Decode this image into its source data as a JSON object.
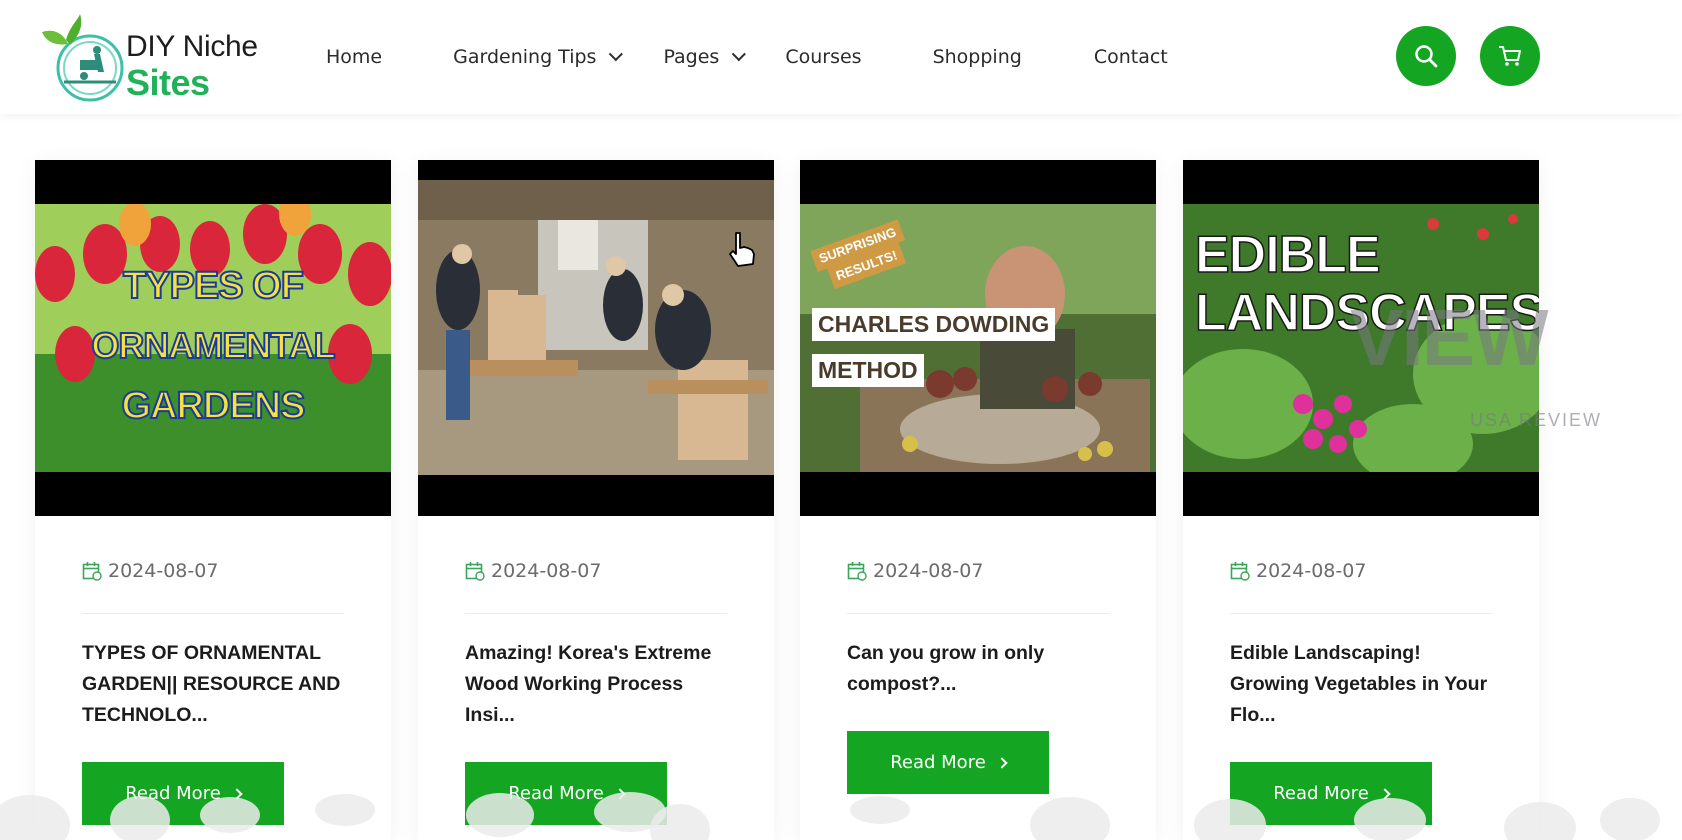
{
  "header": {
    "logo": {
      "line1": "DIY Niche",
      "line2": "Sites",
      "icon": "gardener-wheelbarrow-logo-icon"
    },
    "nav": [
      {
        "label": "Home",
        "has_dropdown": false
      },
      {
        "label": "Gardening Tips",
        "has_dropdown": true
      },
      {
        "label": "Pages",
        "has_dropdown": true
      },
      {
        "label": "Courses",
        "has_dropdown": false
      },
      {
        "label": "Shopping",
        "has_dropdown": false
      },
      {
        "label": "Contact",
        "has_dropdown": false
      }
    ],
    "search_icon": "search-icon",
    "cart_icon": "cart-icon"
  },
  "cards": [
    {
      "thumb_text": [
        "TYPES OF",
        "ORNAMENTAL",
        "GARDENS"
      ],
      "date": "2024-08-07",
      "title": "TYPES OF ORNAMENTAL GARDEN|| RESOURCE AND TECHNOLO...",
      "read_more": "Read More"
    },
    {
      "thumb_text": [],
      "date": "2024-08-07",
      "title": "Amazing! Korea's Extreme Wood Working Process Insi...",
      "read_more": "Read More"
    },
    {
      "thumb_text": [
        "SURPRISING",
        "RESULTS!",
        "CHARLES DOWDING",
        "METHOD"
      ],
      "date": "2024-08-07",
      "title": "Can you grow in only compost?...",
      "read_more": "Read More"
    },
    {
      "thumb_text": [
        "EDIBLE",
        "LANDSCAPES"
      ],
      "date": "2024-08-07",
      "title": "Edible Landscaping! Growing Vegetables in Your Flo...",
      "read_more": "Read More"
    }
  ],
  "watermark": {
    "big": "VIEW",
    "small": "USA REVIEW"
  },
  "colors": {
    "accent": "#14a523",
    "logo_green": "#21b15a",
    "text": "#2b2b2b",
    "date": "#6b6b6b"
  }
}
